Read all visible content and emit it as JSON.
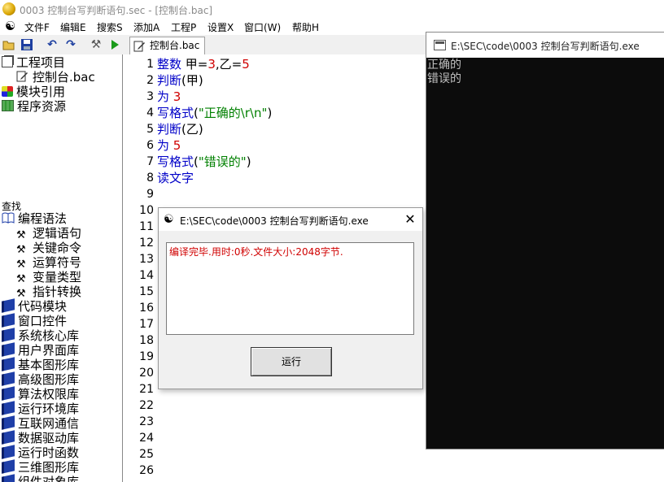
{
  "window": {
    "title": "0003 控制台写判断语句.sec - [控制台.bac]"
  },
  "menu": {
    "logo_glyph": "☯",
    "items": [
      "文件F",
      "编辑E",
      "搜索S",
      "添加A",
      "工程P",
      "设置X",
      "窗口(W)",
      "帮助H"
    ]
  },
  "toolbar": {
    "icons": [
      "open-folder-icon",
      "save-icon",
      "undo-icon",
      "redo-icon",
      "tools-icon",
      "run-icon"
    ]
  },
  "tab": {
    "label": "控制台.bac"
  },
  "project_tree": {
    "root": "工程项目",
    "file": "控制台.bac",
    "modules": "模块引用",
    "resources": "程序资源"
  },
  "find": {
    "label": "查找"
  },
  "syntax_tree": {
    "root": "编程语法",
    "children": [
      "逻辑语句",
      "关键命令",
      "运算符号",
      "变量类型",
      "指针转换"
    ],
    "libraries": [
      "代码模块",
      "窗口控件",
      "系统核心库",
      "用户界面库",
      "基本图形库",
      "高级图形库",
      "算法权限库",
      "运行环境库",
      "互联网通信",
      "数据驱动库",
      "运行时函数",
      "三维图形库",
      "组件对象库"
    ]
  },
  "editor": {
    "line_numbers": [
      "1",
      "2",
      "3",
      "4",
      "5",
      "6",
      "7",
      "8",
      "9",
      "10",
      "11",
      "12",
      "13",
      "14",
      "15",
      "16",
      "17",
      "18",
      "19",
      "20",
      "21",
      "22",
      "23",
      "24",
      "25",
      "26"
    ],
    "lines": [
      [
        {
          "t": "整数 ",
          "c": "kw"
        },
        {
          "t": "甲=",
          "c": "plain"
        },
        {
          "t": "3",
          "c": "num"
        },
        {
          "t": ",乙=",
          "c": "plain"
        },
        {
          "t": "5",
          "c": "num"
        }
      ],
      [
        {
          "t": "判断",
          "c": "kw"
        },
        {
          "t": "(甲)",
          "c": "plain"
        }
      ],
      [
        {
          "t": "为 ",
          "c": "kw"
        },
        {
          "t": "3",
          "c": "num"
        }
      ],
      [
        {
          "t": "写格式",
          "c": "kw"
        },
        {
          "t": "(",
          "c": "plain"
        },
        {
          "t": "\"正确的\\r\\n\"",
          "c": "str"
        },
        {
          "t": ")",
          "c": "plain"
        }
      ],
      [
        {
          "t": "判断",
          "c": "kw"
        },
        {
          "t": "(乙)",
          "c": "plain"
        }
      ],
      [
        {
          "t": "为 ",
          "c": "kw"
        },
        {
          "t": "5",
          "c": "num"
        }
      ],
      [
        {
          "t": "写格式",
          "c": "kw"
        },
        {
          "t": "(",
          "c": "plain"
        },
        {
          "t": "\"错误的\"",
          "c": "str"
        },
        {
          "t": ")",
          "c": "plain"
        }
      ],
      [
        {
          "t": "读文字",
          "c": "kw"
        }
      ]
    ]
  },
  "console": {
    "title": "E:\\SEC\\code\\0003 控制台写判断语句.exe",
    "output": [
      "正确的",
      "错误的"
    ]
  },
  "dialog": {
    "icon_glyph": "☯",
    "title": "E:\\SEC\\code\\0003 控制台写判断语句.exe",
    "close_glyph": "✕",
    "message": "编译完毕.用时:0秒.文件大小:2048字节.",
    "run_label": "运行"
  }
}
